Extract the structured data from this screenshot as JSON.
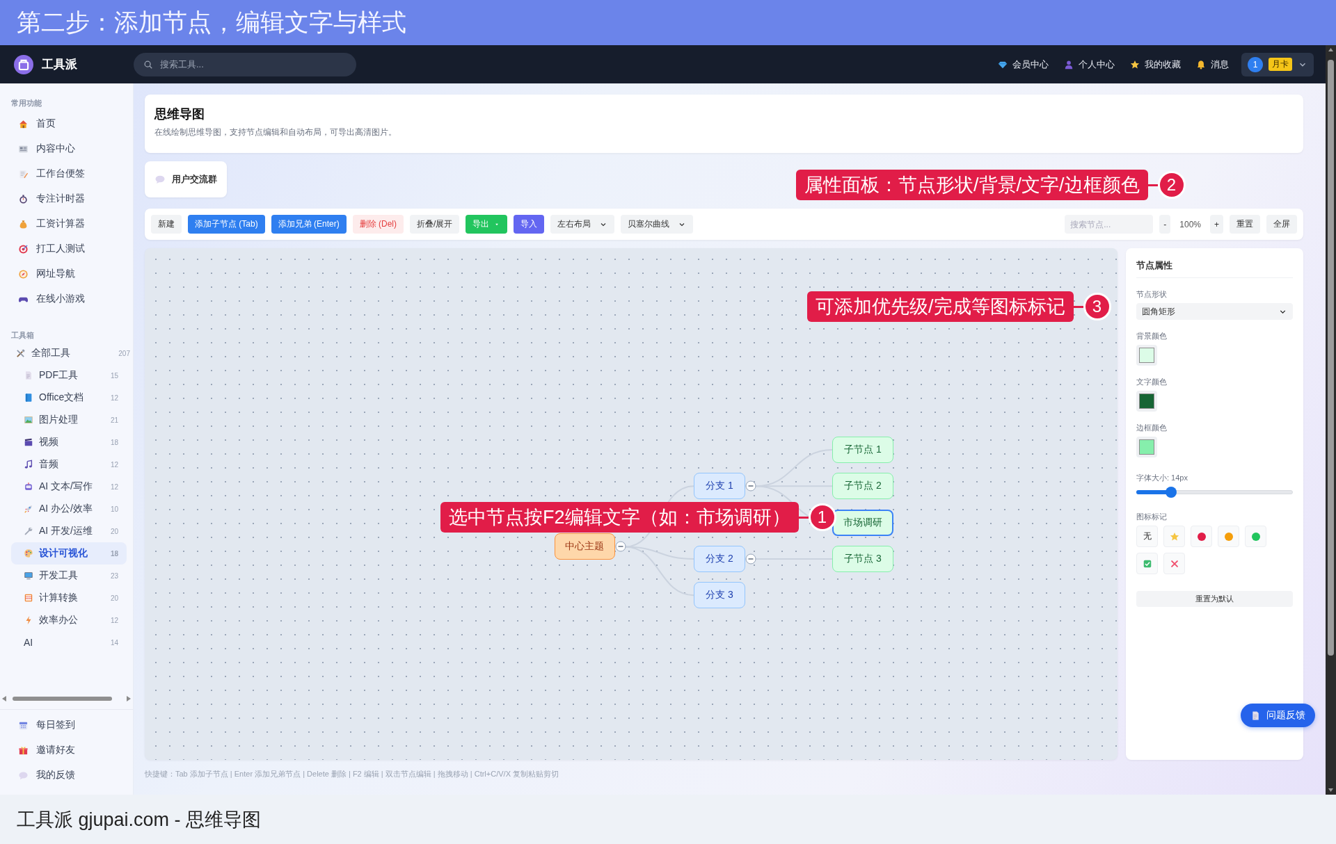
{
  "banner": {
    "title": "第二步：添加节点，编辑文字与样式"
  },
  "header": {
    "brand": "工具派",
    "search": {
      "placeholder": "搜索工具..."
    },
    "links": [
      "会员中心",
      "个人中心",
      "我的收藏",
      "消息"
    ],
    "user": {
      "avatar": "1",
      "badge": "月卡"
    }
  },
  "sidebar": {
    "sections": [
      {
        "title": "常用功能",
        "items": [
          {
            "label": "首页",
            "selected": false
          },
          {
            "label": "内容中心",
            "selected": false
          },
          {
            "label": "工作台便签",
            "selected": false
          },
          {
            "label": "专注计时器",
            "selected": false
          },
          {
            "label": "工资计算器",
            "selected": false
          },
          {
            "label": "打工人测试",
            "selected": false
          },
          {
            "label": "网址导航",
            "selected": false
          },
          {
            "label": "在线小游戏",
            "selected": false
          }
        ]
      },
      {
        "title": "工具箱",
        "items": [
          {
            "label": "全部工具",
            "count": "207",
            "selected": false,
            "children": [
              {
                "label": "PDF工具",
                "count": "15",
                "selected": false
              },
              {
                "label": "Office文档",
                "count": "12",
                "selected": false
              },
              {
                "label": "图片处理",
                "count": "21",
                "selected": false
              },
              {
                "label": "视频",
                "count": "18",
                "selected": false
              },
              {
                "label": "音频",
                "count": "12",
                "selected": false
              },
              {
                "label": "AI 文本/写作",
                "count": "12",
                "selected": false
              },
              {
                "label": "AI 办公/效率",
                "count": "10",
                "selected": false
              },
              {
                "label": "AI 开发/运维",
                "count": "20",
                "selected": false
              },
              {
                "label": "设计可视化",
                "count": "18",
                "selected": true
              },
              {
                "label": "开发工具",
                "count": "23",
                "selected": false
              },
              {
                "label": "计算转换",
                "count": "20",
                "selected": false
              },
              {
                "label": "效率办公",
                "count": "12",
                "selected": false
              },
              {
                "label": "AI",
                "count": "14",
                "selected": false
              }
            ]
          }
        ]
      }
    ],
    "footer_items": [
      "每日签到",
      "邀请好友",
      "我的反馈"
    ]
  },
  "page": {
    "title": "思维导图",
    "description": "在线绘制思维导图，支持节点编辑和自动布局，可导出高清图片。"
  },
  "community_button": "用户交流群",
  "toolbar": {
    "buttons": [
      {
        "label": "新建",
        "kind": "plain"
      },
      {
        "label": "添加子节点 (Tab)",
        "kind": "primary"
      },
      {
        "label": "添加兄弟 (Enter)",
        "kind": "primary"
      },
      {
        "label": "删除 (Del)",
        "kind": "danger"
      },
      {
        "label": "折叠/展开",
        "kind": "plain"
      },
      {
        "label": "导出",
        "kind": "success",
        "dropdown": true
      },
      {
        "label": "导入",
        "kind": "indigo"
      },
      {
        "label": "左右布局",
        "kind": "select"
      },
      {
        "label": "贝塞尔曲线",
        "kind": "select"
      }
    ],
    "search": {
      "placeholder": "搜索节点..."
    },
    "zoom_out": "-",
    "zoom": "100%",
    "zoom_in": "+",
    "reset": "重置",
    "fullscreen": "全屏"
  },
  "mindmap": {
    "root": {
      "text": "中心主题",
      "selected": false,
      "expanded": true,
      "children": [
        {
          "text": "分支 1",
          "selected": false,
          "expanded": true,
          "children": [
            {
              "text": "子节点 1",
              "selected": false
            },
            {
              "text": "子节点 2",
              "selected": false
            },
            {
              "text": "市场调研",
              "selected": true
            }
          ]
        },
        {
          "text": "分支 2",
          "selected": false,
          "expanded": true,
          "children": [
            {
              "text": "子节点 3",
              "selected": false
            }
          ]
        },
        {
          "text": "分支 3",
          "selected": false
        }
      ]
    }
  },
  "properties": {
    "title": "节点属性",
    "shape": {
      "label": "节点形状",
      "value": "圆角矩形"
    },
    "background": {
      "label": "背景颜色",
      "color": "#dcfce7"
    },
    "text_color": {
      "label": "文字颜色",
      "color": "#166534"
    },
    "border_color": {
      "label": "边框颜色",
      "color": "#86efac"
    },
    "font_size": {
      "label": "字体大小: 14px",
      "level": 0.2
    },
    "markers": {
      "label": "图标标记",
      "items": [
        {
          "kind": "none",
          "text": "无"
        },
        {
          "kind": "star"
        },
        {
          "kind": "dot",
          "color": "#e11d48"
        },
        {
          "kind": "dot",
          "color": "#f59e0b"
        },
        {
          "kind": "dot",
          "color": "#22c55e"
        },
        {
          "kind": "check"
        },
        {
          "kind": "cross"
        }
      ]
    },
    "reset": "重置为默认"
  },
  "shortcuts": "快捷键：Tab 添加子节点 | Enter 添加兄弟节点 | Delete 删除 | F2 编辑 | 双击节点编辑 | 拖拽移动 | Ctrl+C/V/X 复制粘贴剪切",
  "feedback_button": "问题反馈",
  "annotations": [
    {
      "number": "2",
      "text": "属性面板：节点形状/背景/文字/边框颜色"
    },
    {
      "number": "3",
      "text": "可添加优先级/完成等图标标记"
    },
    {
      "number": "1",
      "text": "选中节点按F2编辑文字（如：市场调研）"
    }
  ],
  "footer": {
    "caption": "工具派 gjupai.com - 思维导图"
  }
}
